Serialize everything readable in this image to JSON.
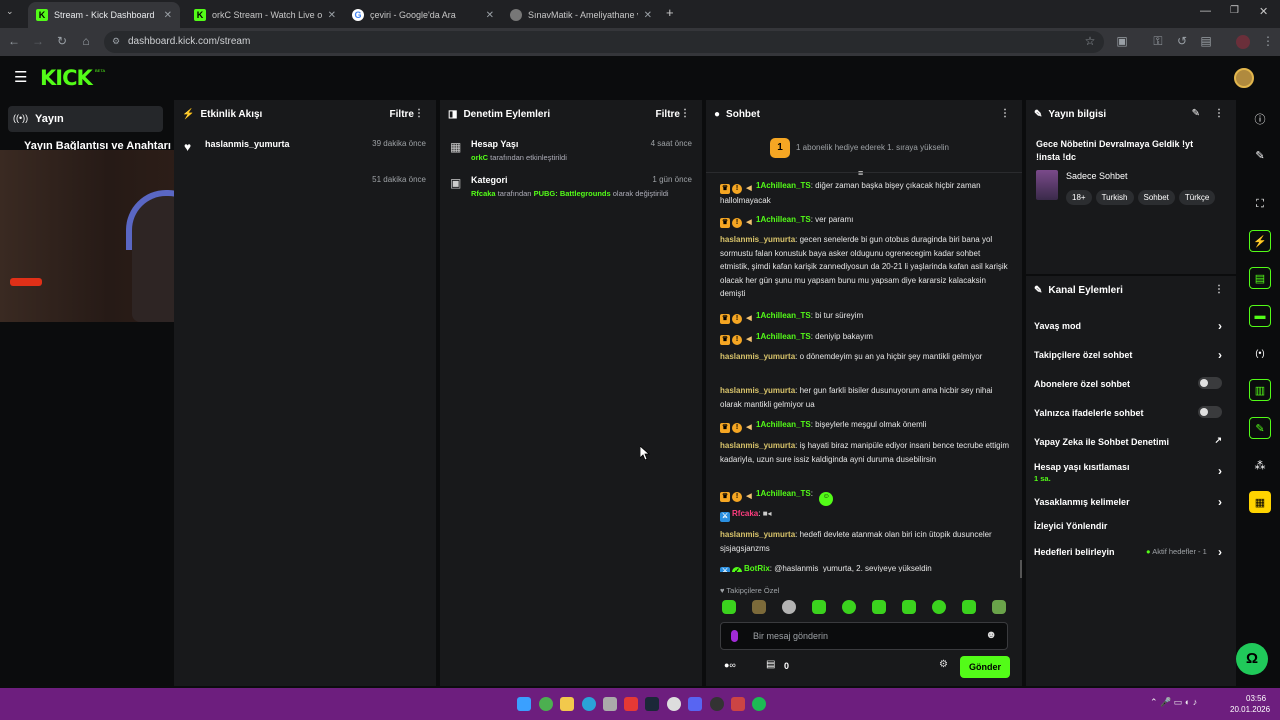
{
  "browser": {
    "tabs": [
      {
        "title": "Stream - Kick Dashboard",
        "favicon": "kick-icon"
      },
      {
        "title": "orkC Stream - Watch Live on Ki",
        "favicon": "kick-icon"
      },
      {
        "title": "çeviri - Google'da Ara",
        "favicon": "google-icon"
      },
      {
        "title": "SınavMatik - Ameliyathane ve Y",
        "favicon": "sinavmatik-icon"
      }
    ],
    "url": "dashboard.kick.com/stream"
  },
  "kick": {
    "logo": "KICK",
    "beta": "BETA",
    "nav_label": "Yayın",
    "stream_key_label": "Yayın Bağlantısı ve Anahtarı"
  },
  "activity": {
    "title": "Etkinlik Akışı",
    "filter": "Filtre",
    "items": [
      {
        "user": "haslanmis_yumurta",
        "time": "39 dakika önce"
      },
      {
        "user": "",
        "time": "51 dakika önce"
      }
    ]
  },
  "moderation": {
    "title": "Denetim Eylemleri",
    "filter": "Filtre",
    "items": [
      {
        "title": "Hesap Yaşı",
        "time": "4 saat önce",
        "actor": "orkC",
        "detail": " tarafından etkinleştirildi",
        "extra": "",
        "extra_tail": ""
      },
      {
        "title": "Kategori",
        "time": "1 gün önce",
        "actor": "Rfcaka",
        "detail": " tarafından ",
        "extra": "PUBG: Battlegrounds",
        "extra_tail": " olarak değiştirildi"
      }
    ]
  },
  "chat": {
    "title": "Sohbet",
    "pinned": {
      "count": "1",
      "text": "1 abonelik hediye ederek 1. sıraya yükselin"
    },
    "messages": [
      {
        "user": "1Achillean_TS",
        "text": "diğer zaman başka bişey çıkacak hiçbir zaman hallolmayacak"
      },
      {
        "user": "1Achillean_TS",
        "text": "ver paramı"
      },
      {
        "user": "haslanmis_yumurta",
        "text": "gecen senelerde bi gun otobus duraginda biri bana yol sormustu falan konustuk baya asker oldugunu ogrenecegim kadar sohbet etmistik, şimdi kafan karişik zannediyosun da 20-21 li yaşlarinda kafan asil karişik olacak her gün şunu mu yapsam bunu mu yapsam diye kararsiz kalacaksin demişti"
      },
      {
        "user": "1Achillean_TS",
        "text": "bi tur süreyim"
      },
      {
        "user": "1Achillean_TS",
        "text": "deniyip bakayım"
      },
      {
        "user": "haslanmis_yumurta",
        "text": "o dönemdeyim şu an ya hiçbir şey mantikli gelmiyor"
      },
      {
        "user": "haslanmis_yumurta",
        "text": "her gun farkli bisiler dusunuyorum ama hicbir sey nihai olarak mantikli gelmiyor ua"
      },
      {
        "user": "1Achillean_TS",
        "text": "bişeylerle meşgul olmak önemli"
      },
      {
        "user": "haslanmis_yumurta",
        "text": "iş hayati biraz manipüle ediyor insani bence tecrube ettigim kadariyla, uzun sure issiz kaldiginda ayni duruma dusebilirsin"
      },
      {
        "user": "1Achillean_TS",
        "text": ""
      },
      {
        "user": "Rfcaka",
        "text": ""
      },
      {
        "user": "haslanmis_yumurta",
        "text": "hedefi devlete atanmak olan biri icin ütopik dusunceler sjsjagsjanzms"
      },
      {
        "user": "BotRix",
        "text": "@haslanmis_yumurta, 2. seviyeye yükseldin"
      }
    ],
    "followers_only": "Takipçilere Özel",
    "input_placeholder": "Bir mesaj gönderin",
    "send_label": "Gönder",
    "points": "0"
  },
  "stream_info": {
    "title": "Yayın bilgisi",
    "stream_title": "Gece Nöbetini Devralmaya Geldik !yt !insta !dc",
    "category": "Sadece Sohbet",
    "tags": [
      "18+",
      "Turkish",
      "Sohbet",
      "Türkçe"
    ]
  },
  "channel_actions": {
    "title": "Kanal Eylemleri",
    "items": [
      {
        "label": "Yavaş mod",
        "kind": "chevron",
        "sub": ""
      },
      {
        "label": "Takipçilere özel sohbet",
        "kind": "chevron",
        "sub": ""
      },
      {
        "label": "Abonelere özel sohbet",
        "kind": "toggle",
        "sub": ""
      },
      {
        "label": "Yalnızca ifadelerle sohbet",
        "kind": "toggle",
        "sub": ""
      },
      {
        "label": "Yapay Zeka ile Sohbet Denetimi",
        "kind": "chart",
        "sub": ""
      },
      {
        "label": "Hesap yaşı kısıtlaması",
        "kind": "chevron",
        "sub": "1 sa."
      },
      {
        "label": "Yasaklanmış kelimeler",
        "kind": "chevron",
        "sub": ""
      },
      {
        "label": "İzleyici Yönlendir",
        "kind": "none",
        "sub": ""
      },
      {
        "label": "Hedefleri belirleyin",
        "kind": "chevron",
        "sub": "Aktif hedefler - 1"
      }
    ]
  },
  "taskbar": {
    "time": "03:56",
    "date": "20.01.2026"
  },
  "colors": {
    "accent": "#53fc18",
    "panel": "#18191b",
    "background": "#0b0c0d",
    "taskbar": "#6d1e7e"
  }
}
